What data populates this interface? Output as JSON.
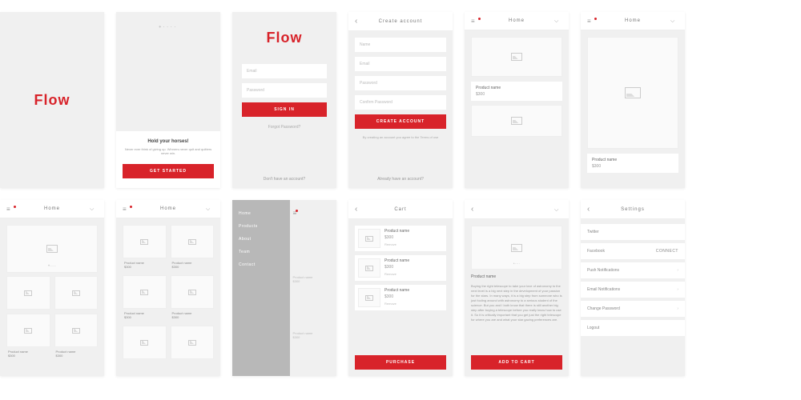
{
  "brand": "Flow",
  "onboard": {
    "title": "Hold your horses!",
    "text": "Never ever think of giving up. Winners never quit and quitters never win.",
    "cta": "GET STARTED"
  },
  "signin": {
    "email": "Email",
    "password": "Password",
    "cta": "SIGN IN",
    "forgot": "Forgot Password?",
    "noacct": "Don't have an account?"
  },
  "create": {
    "title": "Create account",
    "name": "Name",
    "email": "Email",
    "password": "Password",
    "confirm": "Confirm Password",
    "cta": "CREATE ACCOUNT",
    "terms": "By creating an account you agree to the Terms of use",
    "already": "Already have an account?"
  },
  "home": {
    "title": "Home",
    "product": "Product name",
    "price": "$300"
  },
  "menu": {
    "items": [
      "Home",
      "Products",
      "About",
      "Team",
      "Contact"
    ]
  },
  "cart": {
    "title": "Cart",
    "product": "Product name",
    "price": "$300",
    "remove": "Remove",
    "purchase": "PURCHASE"
  },
  "detail": {
    "product": "Product name",
    "desc": "Buying the right telescope to take your love of astronomy to the next level is a big next step in the development of your passion for the stars. In many ways, it is a big step from someone who is just fooling around with astronomy to a serious student of the science. But you and I both know that there is still another big step after buying a telescope before you really know how to use it.\n\nSo it is critically important that you get just the right telescope for where you are and what your star gazing preferences are.",
    "cta": "ADD TO CART"
  },
  "settings": {
    "title": "Settings",
    "rows": [
      "Twitter",
      "Facebook",
      "Push Notifications",
      "Email Notifications",
      "Change Password",
      "Logout"
    ],
    "connect": "CONNECT"
  }
}
